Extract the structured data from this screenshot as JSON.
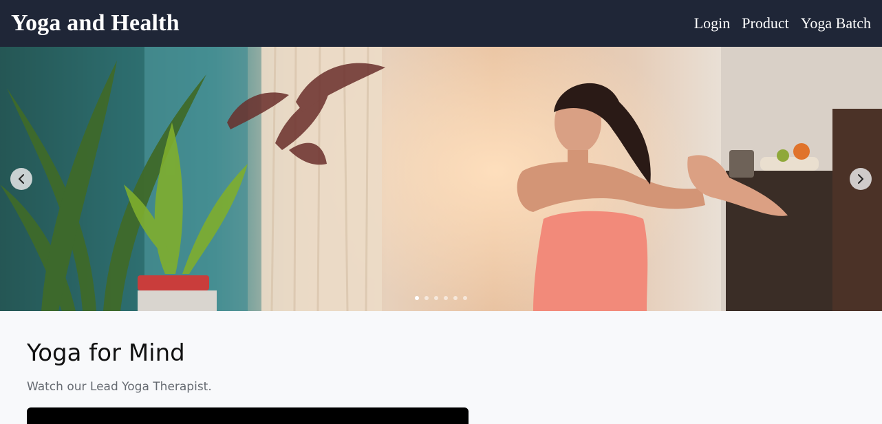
{
  "header": {
    "brand": "Yoga and Health",
    "nav": [
      {
        "label": "Login"
      },
      {
        "label": "Product"
      },
      {
        "label": "Yoga Batch"
      }
    ]
  },
  "carousel": {
    "slide_count": 6,
    "active_index": 0,
    "image_description_icon": "yoga-stretch-photo"
  },
  "main": {
    "title": "Yoga for Mind",
    "subtitle": "Watch our Lead Yoga Therapist."
  },
  "colors": {
    "header_bg": "#1f2637",
    "page_bg": "#f8f9fb"
  }
}
